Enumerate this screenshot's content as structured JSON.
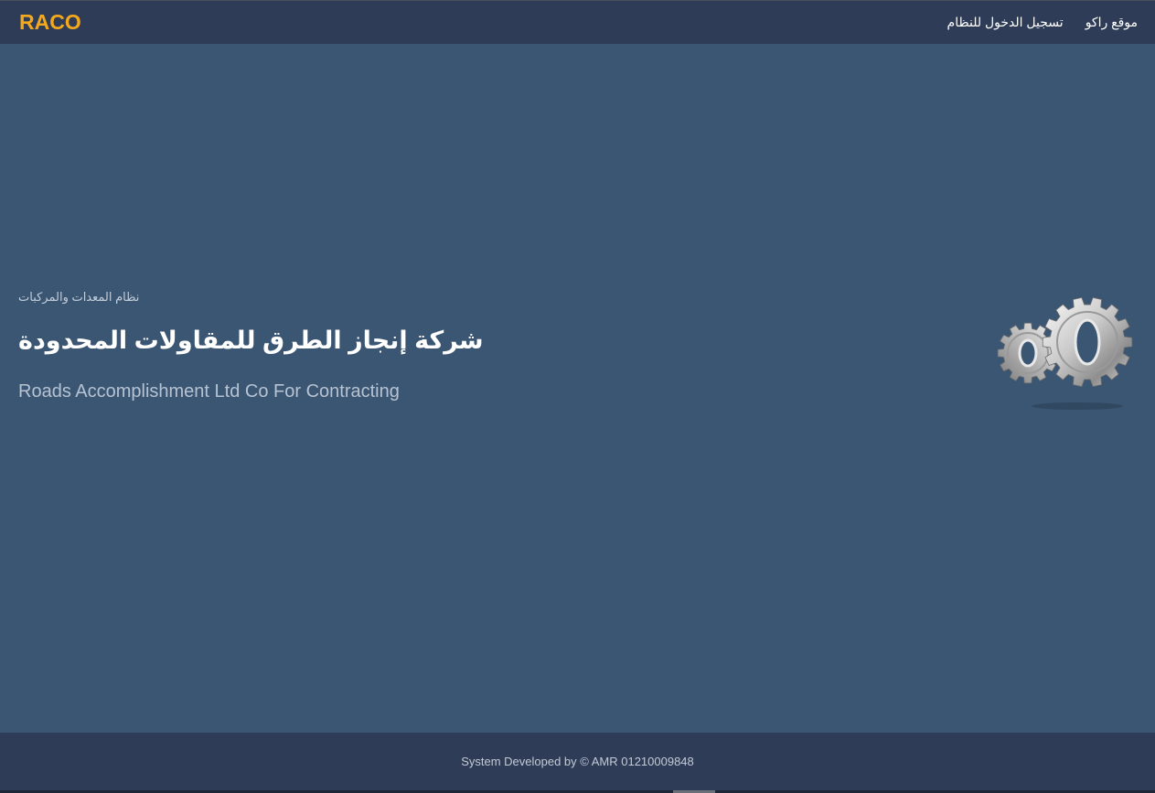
{
  "navbar": {
    "brand": "RACO",
    "links": [
      {
        "label": "موقع راكو"
      },
      {
        "label": "تسجيل الدخول للنظام"
      }
    ]
  },
  "hero": {
    "subtitle": "نظام المعدات والمركبات",
    "title_ar": "شركة إنجاز الطرق للمقاولات المحدودة",
    "title_en": "Roads Accomplishment Ltd Co For Contracting",
    "image_icon": "gears-icon"
  },
  "footer": {
    "text": "System Developed by © AMR 01210009848"
  },
  "colors": {
    "navbar_bg": "#2e3c57",
    "main_bg": "#3b5673",
    "brand": "#f4a91c"
  }
}
